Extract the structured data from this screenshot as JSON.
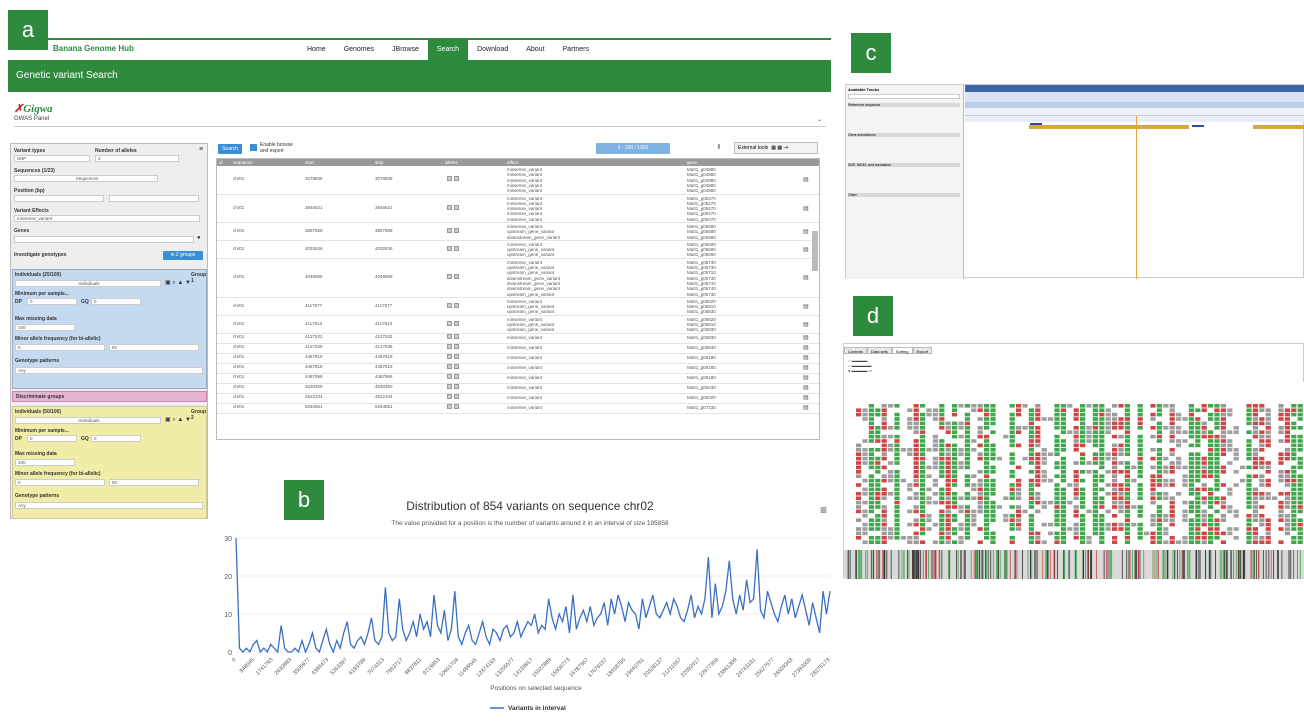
{
  "panel_labels": {
    "a": "a",
    "b": "b",
    "c": "c",
    "d": "d"
  },
  "colors": {
    "brand_green": "#2e8b3d",
    "group1_bg": "#c5d9f1",
    "group2_bg": "#f1eda8",
    "discriminate_bg": "#e5b3d3",
    "line_blue": "#3a6fc4"
  },
  "app": {
    "brand": "Banana Genome Hub",
    "nav": [
      "Home",
      "Genomes",
      "JBrowse",
      "Search",
      "Download",
      "About",
      "Partners"
    ],
    "nav_active": "Search",
    "page_title": "Genetic variant Search",
    "logo": "Gigwa",
    "module": "GWAS Panel"
  },
  "filters": {
    "variant_types_label": "Variant types",
    "variant_types_value": "SNP",
    "num_alleles_label": "Number of alleles",
    "num_alleles_value": "2",
    "sequences_label": "Sequences (1/23)",
    "sequences_value": "Sequences",
    "position_label": "Position (bp)",
    "effects_label": "Variant Effects",
    "effects_value": "missense_variant",
    "genes_label": "Genes",
    "investigate_label": "Investigate genotypes",
    "groups_button": "in 2 groups",
    "group1": {
      "title": "Individuals (25/100)",
      "tag": "Group 1",
      "individuals": "Individuals",
      "min_per_sample": "Minimum per sample...",
      "dp_label": "DP",
      "dp_value": "0",
      "gq_label": "GQ",
      "gq_value": "0",
      "missing_label": "Max missing data",
      "missing_value": "100",
      "maf_label": "Minor allele frequency (for bi-allelic)",
      "maf_min": "0",
      "maf_max": "50",
      "pattern_label": "Genotype patterns",
      "pattern_value": "Any"
    },
    "discriminate": "Discriminate groups",
    "group2": {
      "title": "Individuals (50/100)",
      "tag": "Group 2",
      "individuals": "Individuals",
      "min_per_sample": "Minimum per sample...",
      "dp_label": "DP",
      "dp_value": "0",
      "gq_label": "GQ",
      "gq_value": "0",
      "missing_label": "Max missing data",
      "missing_value": "100",
      "maf_label": "Minor allele frequency (for bi-allelic)",
      "maf_min": "0",
      "maf_max": "50",
      "pattern_label": "Genotype patterns",
      "pattern_value": "Any"
    }
  },
  "results": {
    "search_button": "Search",
    "enable_browse": "Enable browse and export",
    "pagination": "1 - 100 / 1001",
    "external_tools": "External tools",
    "columns": [
      "id",
      "sequence",
      "start",
      "stop",
      "alleles",
      "effect",
      "gene"
    ],
    "rows": [
      {
        "seq": "chr01",
        "start": "3078838",
        "stop": "3078838",
        "effects": [
          "missense_variant",
          "missense_variant",
          "missense_variant",
          "missense_variant",
          "missense_variant"
        ],
        "genes": [
          "Ma01_g04880",
          "Ma01_g04880",
          "Ma01_g04880",
          "Ma01_g04880",
          "Ma01_g04880"
        ]
      },
      {
        "seq": "chr01",
        "start": "3846621",
        "stop": "3846621",
        "effects": [
          "missense_variant",
          "missense_variant",
          "missense_variant",
          "missense_variant",
          "missense_variant"
        ],
        "genes": [
          "Ma01_g05470",
          "Ma01_g05470",
          "Ma01_g05470",
          "Ma01_g05470",
          "Ma01_g05470"
        ]
      },
      {
        "seq": "chr01",
        "start": "3857569",
        "stop": "3857569",
        "effects": [
          "missense_variant",
          "upstream_gene_variant",
          "downstream_gene_variant"
        ],
        "genes": [
          "Ma01_g05580",
          "Ma01_g05580",
          "Ma01_g05580"
        ]
      },
      {
        "seq": "chr01",
        "start": "4032636",
        "stop": "4032636",
        "effects": [
          "missense_variant",
          "upstream_gene_variant",
          "upstream_gene_variant"
        ],
        "genes": [
          "Ma01_g05690",
          "Ma01_g05690",
          "Ma01_g05690"
        ]
      },
      {
        "seq": "chr01",
        "start": "4048958",
        "stop": "4048958",
        "effects": [
          "missense_variant",
          "upstream_gene_variant",
          "upstream_gene_variant",
          "downstream_gene_variant",
          "downstream_gene_variant",
          "downstream_gene_variant",
          "upstream_gene_variant"
        ],
        "genes": [
          "Ma01_g05730",
          "Ma01_g05730",
          "Ma01_g05710",
          "Ma01_g05730",
          "Ma01_g05740",
          "Ma01_g05740",
          "Ma01_g05730"
        ]
      },
      {
        "seq": "chr01",
        "start": "4117577",
        "stop": "4117577",
        "effects": [
          "missense_variant",
          "upstream_gene_variant",
          "upstream_gene_variant"
        ],
        "genes": [
          "Ma01_g05820",
          "Ma01_g05810",
          "Ma01_g05830"
        ]
      },
      {
        "seq": "chr01",
        "start": "4117613",
        "stop": "4117613",
        "effects": [
          "missense_variant",
          "upstream_gene_variant",
          "upstream_gene_variant"
        ],
        "genes": [
          "Ma01_g05820",
          "Ma01_g05810",
          "Ma01_g05830"
        ]
      },
      {
        "seq": "chr01",
        "start": "4127532",
        "stop": "4127532",
        "effects": [
          "missense_variant"
        ],
        "genes": [
          "Ma01_g05830"
        ]
      },
      {
        "seq": "chr01",
        "start": "4127536",
        "stop": "4127536",
        "effects": [
          "missense_variant"
        ],
        "genes": [
          "Ma01_g05840"
        ]
      },
      {
        "seq": "chr01",
        "start": "4487818",
        "stop": "4487818",
        "effects": [
          "missense_variant"
        ],
        "genes": [
          "Ma01_g06180"
        ]
      },
      {
        "seq": "chr01",
        "start": "4487818",
        "stop": "4487818",
        "effects": [
          "missense_variant"
        ],
        "genes": [
          "Ma01_g06180"
        ]
      },
      {
        "seq": "chr01",
        "start": "4487958",
        "stop": "4487958",
        "effects": [
          "missense_variant"
        ],
        "genes": [
          "Ma01_g06180"
        ]
      },
      {
        "seq": "chr01",
        "start": "4630460",
        "stop": "4630460",
        "effects": [
          "missense_variant"
        ],
        "genes": [
          "Ma01_g06230"
        ]
      },
      {
        "seq": "chr01",
        "start": "4622104",
        "stop": "4622104",
        "effects": [
          "missense_variant"
        ],
        "genes": [
          "Ma01_g06320"
        ]
      },
      {
        "seq": "chr01",
        "start": "5264651",
        "stop": "5264651",
        "effects": [
          "missense_variant"
        ],
        "genes": [
          "Ma01_g07230"
        ]
      }
    ]
  },
  "chart_data": {
    "type": "line",
    "title": "Distribution of 854 variants on sequence chr02",
    "subtitle": "The value provided for a position is the number of variants around it in an interval of size 195858",
    "xlabel": "Positions on selected sequence",
    "ylabel": "",
    "ylim": [
      0,
      30
    ],
    "yticks": [
      0,
      10,
      20,
      30
    ],
    "legend": "Variants in interval",
    "legend_position": "bottom",
    "xtick_labels": [
      "0",
      "848045",
      "1741793",
      "2630883",
      "3505977",
      "4386473",
      "5263397",
      "6193789",
      "7074313",
      "7953717",
      "8837811",
      "9719853",
      "10601709",
      "11489545",
      "12374193",
      "13255577",
      "14139917",
      "15022889",
      "15906773",
      "16787567",
      "17678157",
      "18558765",
      "19440761",
      "20328137",
      "21211557",
      "22093417",
      "22977359",
      "23861309",
      "24743181",
      "25627577",
      "26509343",
      "27393009",
      "28275173"
    ],
    "series": [
      {
        "name": "Variants in interval",
        "values": [
          30,
          1,
          0,
          1,
          0,
          2,
          3,
          0,
          1,
          0,
          2,
          1,
          0,
          7,
          1,
          0,
          0,
          1,
          0,
          3,
          0,
          2,
          5,
          1,
          0,
          3,
          6,
          2,
          0,
          3,
          1,
          5,
          8,
          2,
          1,
          3,
          4,
          2,
          5,
          9,
          3,
          2,
          4,
          17,
          5,
          3,
          4,
          14,
          6,
          3,
          5,
          8,
          4,
          10,
          6,
          8,
          4,
          15,
          7,
          5,
          11,
          3,
          6,
          16,
          4,
          2,
          5,
          7,
          3,
          2,
          5,
          8,
          4,
          2,
          6,
          5,
          3,
          6,
          7,
          4,
          5,
          8,
          4,
          6,
          8,
          7,
          10,
          5,
          7,
          6,
          14,
          9,
          6,
          10,
          8,
          12,
          5,
          15,
          6,
          9,
          11,
          8,
          12,
          7,
          9,
          10,
          13,
          7,
          14,
          10,
          15,
          12,
          8,
          13,
          11,
          10,
          6,
          14,
          9,
          12,
          15,
          10,
          9,
          11,
          13,
          10,
          14,
          12,
          9,
          8,
          11,
          15,
          9,
          12,
          10,
          14,
          25,
          9,
          18,
          10,
          12,
          16,
          24,
          14,
          10,
          15,
          11,
          19,
          13,
          14,
          27,
          11,
          9,
          16,
          13,
          10,
          8,
          12,
          15,
          10,
          14,
          9,
          12,
          15,
          11,
          7,
          13,
          9,
          5,
          16,
          10,
          16
        ]
      }
    ]
  },
  "panel_c": {
    "available_tracks": "Available Tracks",
    "menu": [
      "Genome",
      "Track",
      "View",
      "Help"
    ],
    "sections": [
      "Reference sequence",
      "Gene annotations",
      "SNP, INDEL and annotation",
      "Other"
    ]
  },
  "panel_d": {
    "tabs": [
      "Controls",
      "Data sets",
      "Sorting",
      "Export"
    ],
    "active_tab": "Sorting"
  }
}
